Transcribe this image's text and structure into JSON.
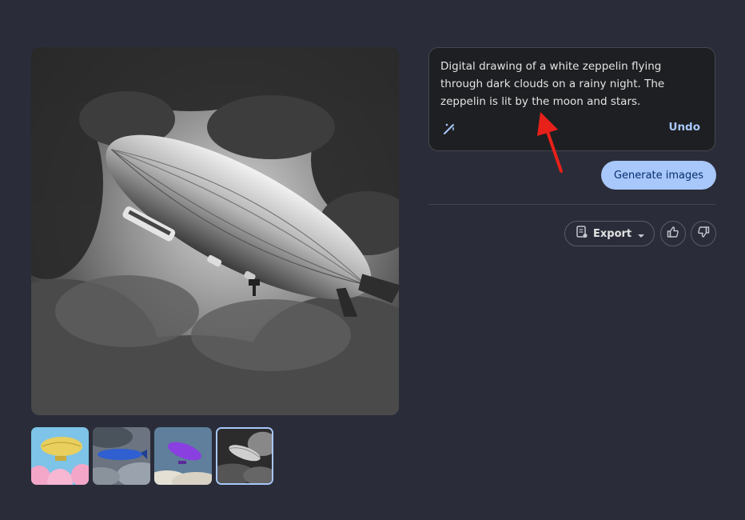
{
  "prompt": {
    "text": "Digital drawing of a white zeppelin flying through dark clouds on a rainy night. The zeppelin is lit by the moon and stars.",
    "undo_label": "Undo",
    "edit_icon": "pencil-sparkle-icon"
  },
  "actions": {
    "generate_label": "Generate images",
    "export_label": "Export",
    "export_icon": "export-icon",
    "export_dropdown_icon": "caret-down-icon",
    "thumbs_up_icon": "thumbs-up-icon",
    "thumbs_down_icon": "thumbs-down-icon"
  },
  "thumbnails": {
    "count": 4,
    "selected_index": 4,
    "items": [
      "yellow zeppelin over pink clouds",
      "blue zeppelin in cloudy sky",
      "purple zeppelin above clouds",
      "white zeppelin in dark clouds"
    ]
  },
  "colors": {
    "background": "#2a2d39",
    "accent": "#a8c7fa",
    "annotation_arrow": "#e8201a"
  }
}
